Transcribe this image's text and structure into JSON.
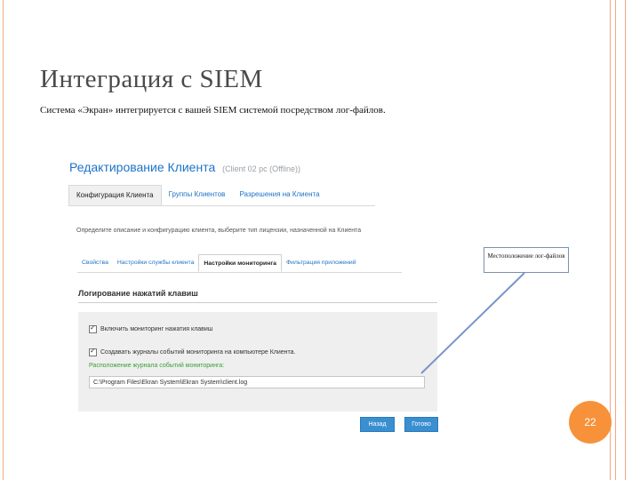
{
  "slide": {
    "title": "Интеграция с SIEM",
    "subtitle": "Система «Экран» интегрируется с вашей SIEM системой посредством лог-файлов.",
    "page_number": "22",
    "accent_color": "#f7923a"
  },
  "client_window": {
    "title": "Редактирование Клиента",
    "subtitle": "(Client 02 pc (Offline))",
    "main_tabs": [
      "Конфигурация Клиента",
      "Группы Клиентов",
      "Разрешения на Клиента"
    ],
    "description": "Определите описание и конфигурацию клиента, выберите тип лицензии, назначенной на Клиента",
    "sub_tabs": [
      "Свойства",
      "Настройки службы клиента",
      "Настройки мониторинга",
      "Фильтрация приложений"
    ],
    "section_title": "Логирование нажатий клавиш",
    "checkbox_1": "Включить мониторинг нажатия клавиш",
    "checkbox_2": "Создавать журналы событий мониторинга на компьютере Клиента.",
    "log_location_label": "Расположение журнала событий мониторинга:",
    "log_path": "C:\\Program Files\\Ekran System\\Ekran System\\client.log",
    "back_button": "Назад",
    "done_button": "Готово"
  },
  "callout": {
    "text": "Местоположение лог-файлов"
  }
}
